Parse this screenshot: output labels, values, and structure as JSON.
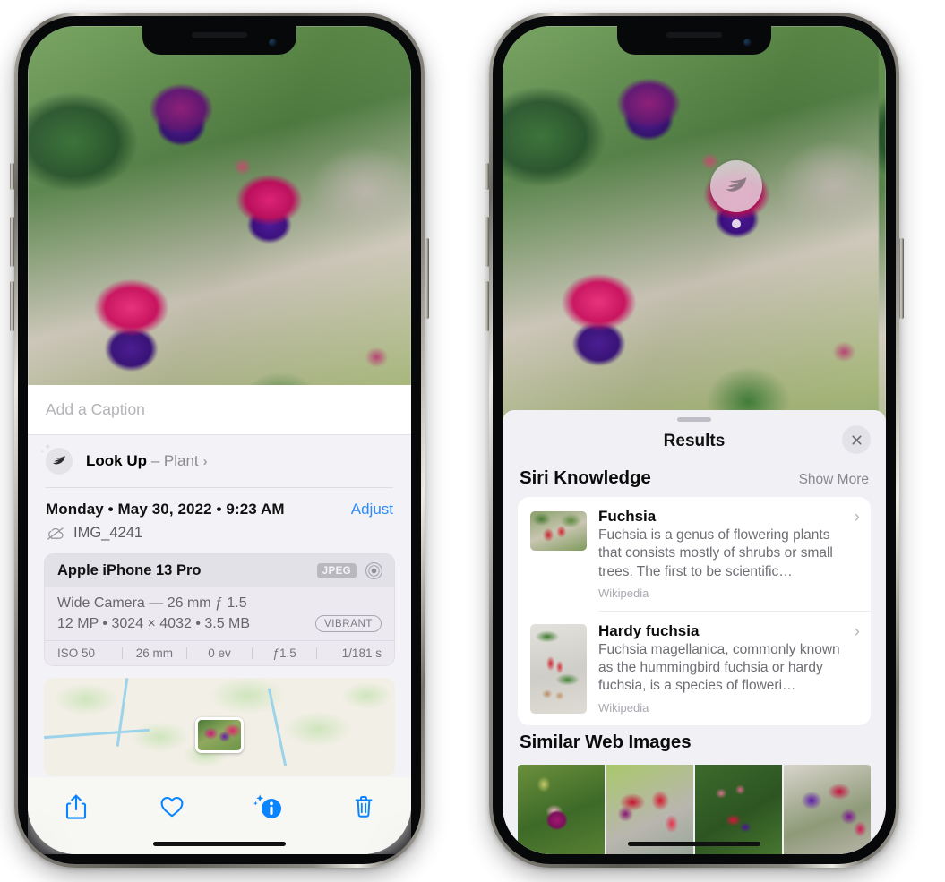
{
  "left_phone": {
    "photo_alt": "fuchsia-flowers-photo",
    "caption": {
      "placeholder": "Add a Caption",
      "value": ""
    },
    "lookup": {
      "icon": "leaf-icon",
      "sparkle_icon": "sparkles-icon",
      "label": "Look Up",
      "dash": " – ",
      "subject": "Plant",
      "chevron": "›"
    },
    "meta": {
      "date": "Monday • May 30, 2022 • 9:23 AM",
      "adjust": "Adjust",
      "cloud_icon": "cloud-slash-icon",
      "filename": "IMG_4241"
    },
    "exif": {
      "model": "Apple iPhone 13 Pro",
      "format_badge": "JPEG",
      "lens_icon": "lens-icon",
      "lens_line": "Wide Camera — 26 mm ƒ 1.5",
      "size_line": "12 MP • 3024 × 4032 • 3.5 MB",
      "style_badge": "VIBRANT",
      "stats": [
        "ISO 50",
        "26 mm",
        "0 ev",
        "ƒ1.5",
        "1/181 s"
      ]
    },
    "map": {
      "name": "photo-location-map",
      "pin": "photo-thumbnail-pin"
    },
    "toolbar": [
      {
        "name": "share-button",
        "icon": "share-icon"
      },
      {
        "name": "favorite-button",
        "icon": "heart-icon"
      },
      {
        "name": "info-button",
        "icon": "info-sparkle-icon"
      },
      {
        "name": "delete-button",
        "icon": "trash-icon"
      }
    ],
    "accent_color": "#0a84ff"
  },
  "right_phone": {
    "photo_alt": "fuchsia-flowers-photo",
    "visual_lookup_badge": {
      "icon": "leaf-icon",
      "name": "visual-lookup-badge"
    },
    "sheet": {
      "grabber": "sheet-grabber",
      "title": "Results",
      "close_icon": "close-icon"
    },
    "siri_knowledge": {
      "title": "Siri Knowledge",
      "action": "Show More",
      "items": [
        {
          "title": "Fuchsia",
          "desc": "Fuchsia is a genus of flowering plants that consists mostly of shrubs or small trees. The first to be scientific…",
          "source": "Wikipedia",
          "thumb": "fuchsia-flower-thumbnail"
        },
        {
          "title": "Hardy fuchsia",
          "desc": "Fuchsia magellanica, commonly known as the hummingbird fuchsia or hardy fuchsia, is a species of floweri…",
          "source": "Wikipedia",
          "thumb": "hardy-fuchsia-specimen-thumbnail"
        }
      ],
      "chevron": "›"
    },
    "similar_web_images": {
      "title": "Similar Web Images",
      "items": [
        {
          "name": "similar-image-1"
        },
        {
          "name": "similar-image-2"
        },
        {
          "name": "similar-image-3"
        },
        {
          "name": "similar-image-4"
        }
      ]
    }
  }
}
